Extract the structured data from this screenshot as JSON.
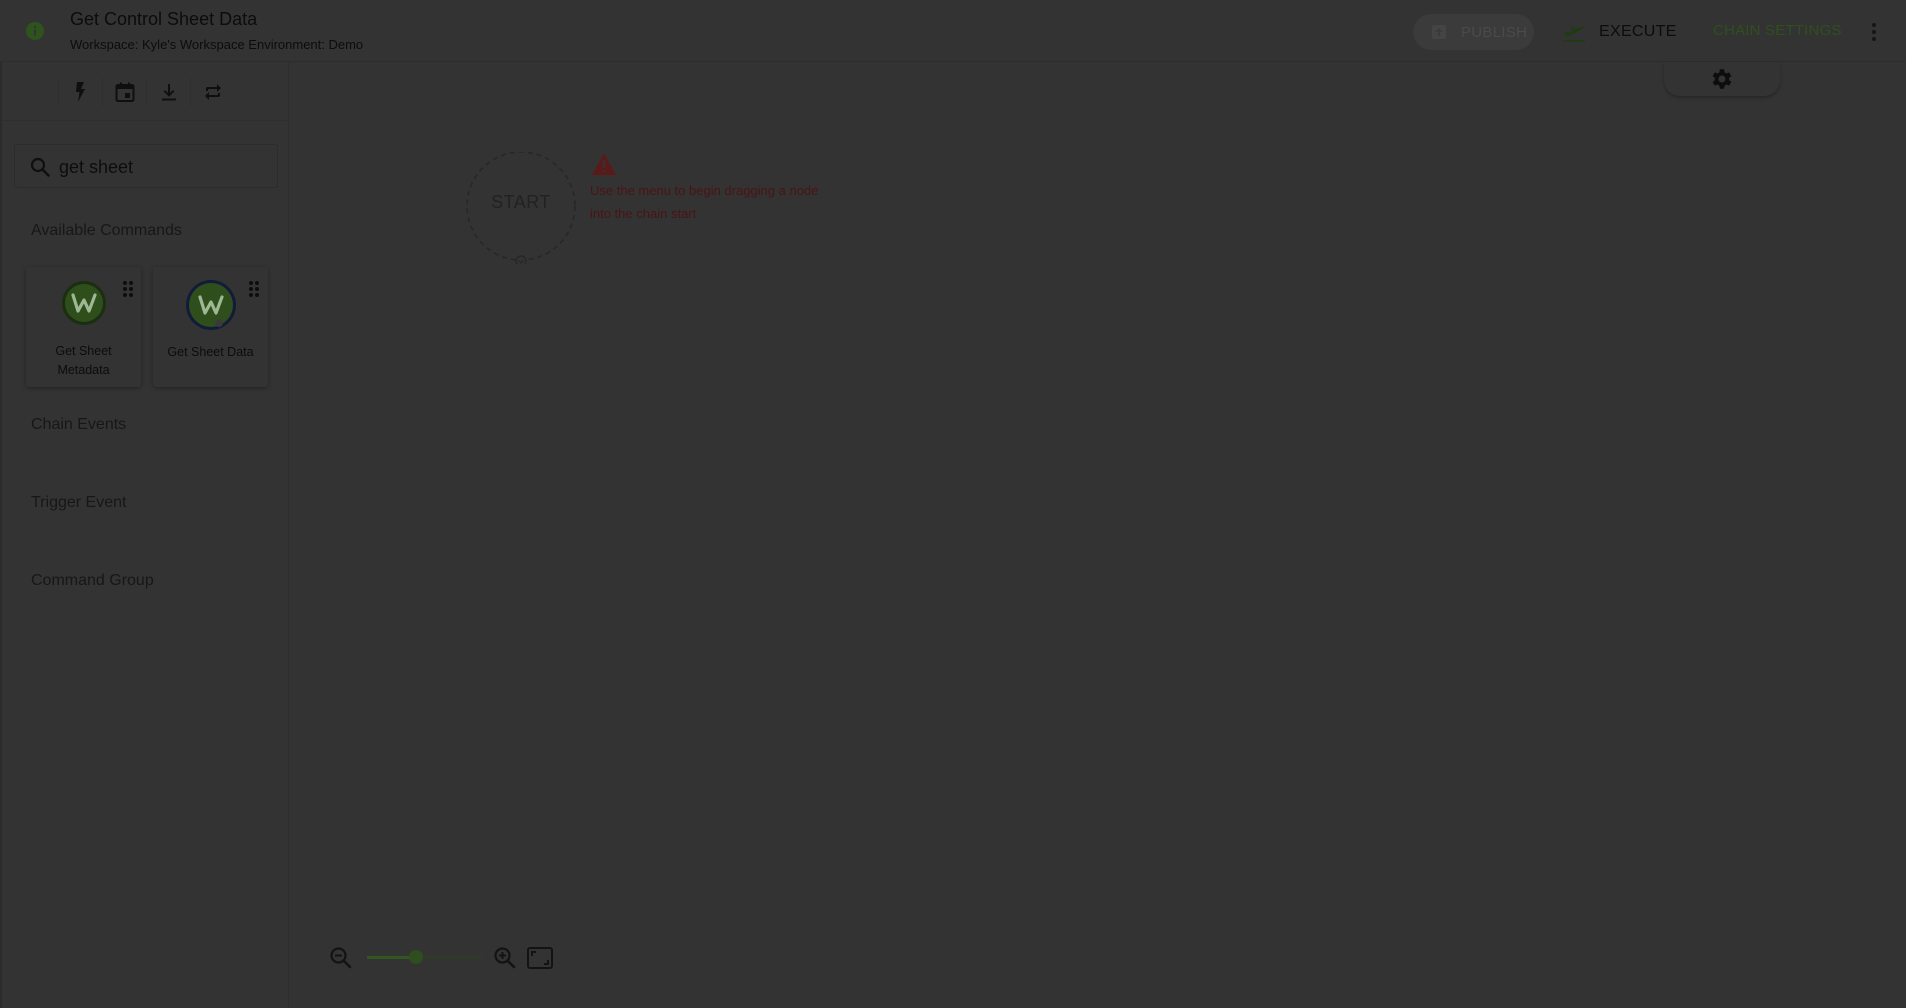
{
  "header": {
    "title": "Get Control Sheet Data",
    "subtitle": "Workspace: Kyle's Workspace Environment: Demo",
    "publish_label": "PUBLISH",
    "execute_label": "EXECUTE",
    "chain_settings_label": "CHAIN SETTINGS"
  },
  "sidebar": {
    "toolbar_icons": [
      "lightning-icon",
      "calendar-icon",
      "download-icon",
      "repeat-icon"
    ],
    "search": {
      "value": "get sheet"
    },
    "available_commands_label": "Available Commands",
    "commands": [
      {
        "name": "Get Sheet Metadata"
      },
      {
        "name": "Get Sheet Data"
      }
    ],
    "sections": [
      "Chain Events",
      "Trigger Event",
      "Command Group"
    ]
  },
  "canvas": {
    "start_label": "START",
    "warning": "Use the menu to begin dragging a node into the chain start"
  },
  "zoom": {
    "level": 0.42
  },
  "colors": {
    "background": "#333333",
    "accent_green": "#2f4f1e",
    "warning_red": "#5a1a1a"
  }
}
